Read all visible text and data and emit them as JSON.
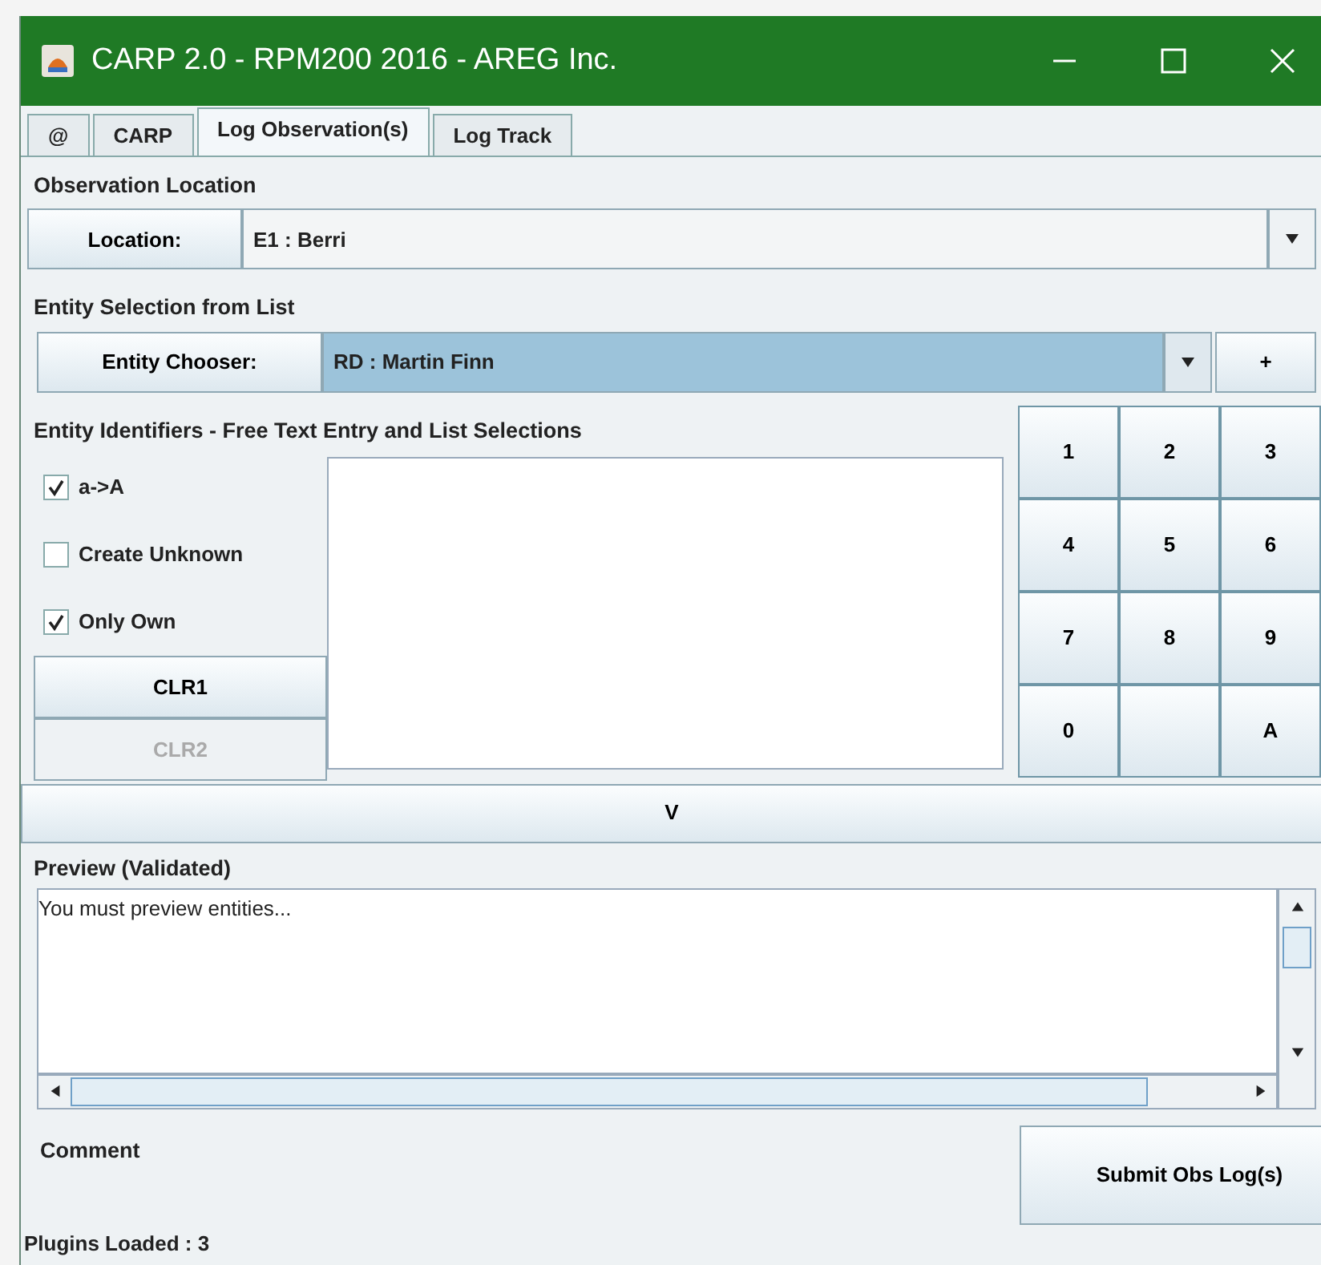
{
  "window": {
    "title": "CARP 2.0 - RPM200 2016 - AREG Inc."
  },
  "tabs": [
    {
      "label": "@",
      "selected": false
    },
    {
      "label": "CARP",
      "selected": false
    },
    {
      "label": "Log Observation(s)",
      "selected": true
    },
    {
      "label": "Log Track",
      "selected": false
    }
  ],
  "observation_location": {
    "heading": "Observation Location",
    "button": "Location:",
    "value": "E1 : Berri"
  },
  "entity_selection": {
    "heading": "Entity Selection from List",
    "button": "Entity Chooser:",
    "value": "RD : Martin Finn",
    "add_button": "+"
  },
  "entity_identifiers": {
    "heading": "Entity Identifiers - Free Text Entry and List Selections",
    "options": [
      {
        "label": "a->A",
        "checked": true
      },
      {
        "label": "Create Unknown",
        "checked": false
      },
      {
        "label": "Only Own",
        "checked": true
      }
    ],
    "buttons": [
      {
        "label": "CLR1",
        "disabled": false
      },
      {
        "label": "CLR2",
        "disabled": true
      }
    ],
    "keypad": [
      {
        "kind": "key",
        "label": "1"
      },
      {
        "kind": "key",
        "label": "2"
      },
      {
        "kind": "key",
        "label": "3"
      },
      {
        "kind": "key",
        "label": "4"
      },
      {
        "kind": "key",
        "label": "5"
      },
      {
        "kind": "key",
        "label": "6"
      },
      {
        "kind": "key",
        "label": "7"
      },
      {
        "kind": "key",
        "label": "8"
      },
      {
        "kind": "key",
        "label": "9"
      },
      {
        "kind": "key",
        "label": "0"
      },
      {
        "kind": "blank"
      },
      {
        "kind": "key",
        "label": "A"
      }
    ]
  },
  "expand_button": "V",
  "preview": {
    "heading": "Preview (Validated)",
    "text": "You must preview entities..."
  },
  "comment": {
    "label": "Comment"
  },
  "submit_button": "Submit Obs Log(s)",
  "status_bar": "Plugins Loaded : 3"
}
